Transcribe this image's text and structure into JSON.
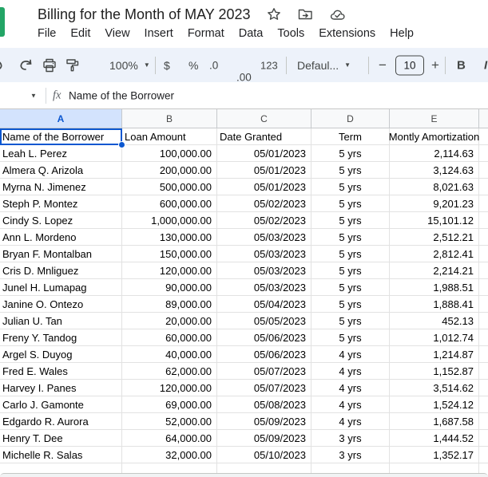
{
  "titlebar": {
    "doc_title": "Billing for the Month of MAY 2023"
  },
  "menubar": {
    "items": [
      "File",
      "Edit",
      "View",
      "Insert",
      "Format",
      "Data",
      "Tools",
      "Extensions",
      "Help"
    ]
  },
  "toolbar": {
    "zoom_level": "100%",
    "currency_label": "$",
    "percent_label": "%",
    "decrease_decimal_label": ".0",
    "increase_decimal_label": ".00",
    "more_formats_label": "123",
    "font_name": "Defaul...",
    "decrease_font_label": "−",
    "font_size": "10",
    "increase_font_label": "+",
    "bold_label": "B"
  },
  "formula_bar": {
    "fx_label": "fx",
    "value": "Name of the Borrower"
  },
  "grid": {
    "column_letters": [
      "A",
      "B",
      "C",
      "D",
      "E"
    ],
    "rows": [
      {
        "cells": [
          "Name of the Borrower",
          "Loan Amount",
          "Date Granted",
          "Term",
          "Montly Amortization"
        ]
      },
      {
        "cells": [
          "Leah L. Perez",
          "100,000.00",
          "05/01/2023",
          "5 yrs",
          "2,114.63"
        ]
      },
      {
        "cells": [
          "Almera Q. Arizola",
          "200,000.00",
          "05/01/2023",
          "5 yrs",
          "3,124.63"
        ]
      },
      {
        "cells": [
          "Myrna N. Jimenez",
          "500,000.00",
          "05/01/2023",
          "5 yrs",
          "8,021.63"
        ]
      },
      {
        "cells": [
          "Steph P. Montez",
          "600,000.00",
          "05/02/2023",
          "5 yrs",
          "9,201.23"
        ]
      },
      {
        "cells": [
          "Cindy S. Lopez",
          "1,000,000.00",
          "05/02/2023",
          "5 yrs",
          "15,101.12"
        ]
      },
      {
        "cells": [
          "Ann L. Mordeno",
          "130,000.00",
          "05/03/2023",
          "5 yrs",
          "2,512.21"
        ]
      },
      {
        "cells": [
          "Bryan F. Montalban",
          "150,000.00",
          "05/03/2023",
          "5 yrs",
          "2,812.41"
        ]
      },
      {
        "cells": [
          "Cris D. Mnliguez",
          "120,000.00",
          "05/03/2023",
          "5 yrs",
          "2,214.21"
        ]
      },
      {
        "cells": [
          "Junel H. Lumapag",
          "90,000.00",
          "05/03/2023",
          "5 yrs",
          "1,988.51"
        ]
      },
      {
        "cells": [
          "Janine O. Ontezo",
          "89,000.00",
          "05/04/2023",
          "5 yrs",
          "1,888.41"
        ]
      },
      {
        "cells": [
          "Julian U. Tan",
          "20,000.00",
          "05/05/2023",
          "5 yrs",
          "452.13"
        ]
      },
      {
        "cells": [
          "Freny Y. Tandog",
          "60,000.00",
          "05/06/2023",
          "5 yrs",
          "1,012.74"
        ]
      },
      {
        "cells": [
          "Argel S. Duyog",
          "40,000.00",
          "05/06/2023",
          "4 yrs",
          "1,214.87"
        ]
      },
      {
        "cells": [
          "Fred E. Wales",
          "62,000.00",
          "05/07/2023",
          "4 yrs",
          "1,152.87"
        ]
      },
      {
        "cells": [
          "Harvey I. Panes",
          "120,000.00",
          "05/07/2023",
          "4 yrs",
          "3,514.62"
        ]
      },
      {
        "cells": [
          "Carlo J. Gamonte",
          "69,000.00",
          "05/08/2023",
          "4 yrs",
          "1,524.12"
        ]
      },
      {
        "cells": [
          "Edgardo R. Aurora",
          "52,000.00",
          "05/09/2023",
          "4 yrs",
          "1,687.58"
        ]
      },
      {
        "cells": [
          "Henry T. Dee",
          "64,000.00",
          "05/09/2023",
          "3 yrs",
          "1,444.52"
        ]
      },
      {
        "cells": [
          "Michelle R. Salas",
          "32,000.00",
          "05/10/2023",
          "3 yrs",
          "1,352.17"
        ]
      }
    ]
  },
  "colors": {
    "accent": "#0b57d0",
    "selected_header_bg": "#d3e3fd",
    "toolbar_bg": "#edf2fa",
    "logo_green": "#23a566",
    "gridline": "#e2e2e2"
  }
}
